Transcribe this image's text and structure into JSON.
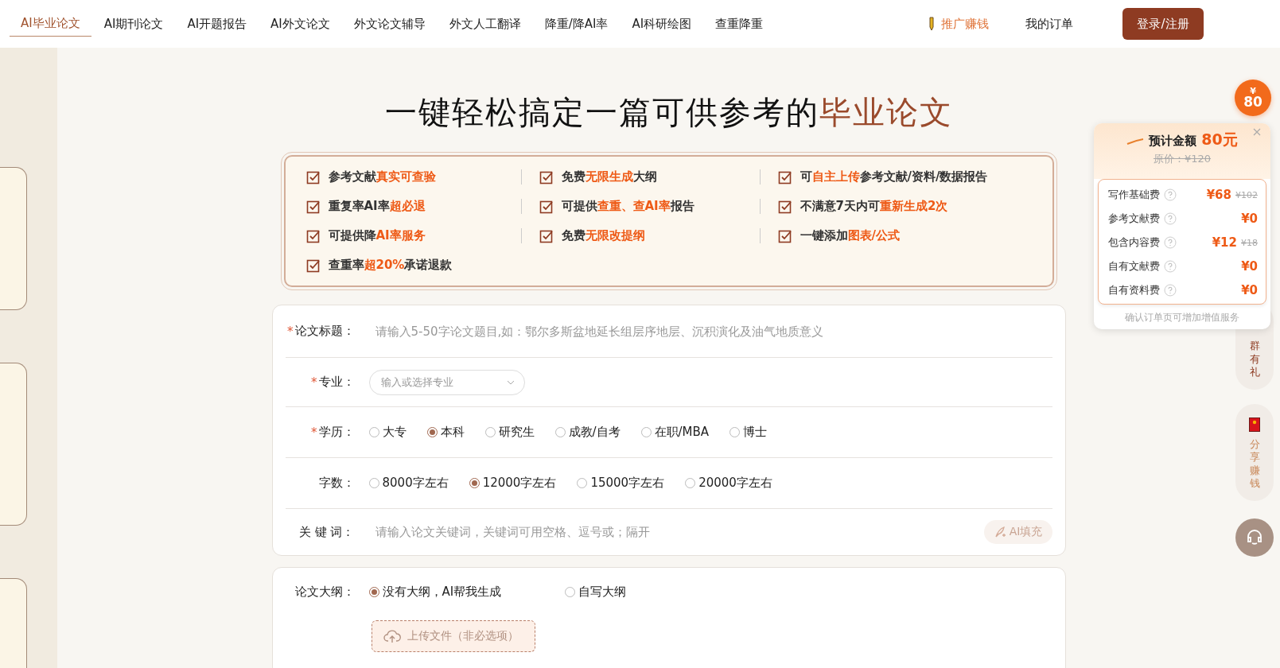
{
  "nav": {
    "items": [
      {
        "label": "AI毕业论文",
        "selected": true
      },
      {
        "label": "AI期刊论文",
        "selected": false
      },
      {
        "label": "AI开题报告",
        "selected": false
      },
      {
        "label": "AI外文论文",
        "selected": false
      },
      {
        "label": "外文论文辅导",
        "selected": false
      },
      {
        "label": "外文人工翻译",
        "selected": false
      },
      {
        "label": "降重/降AI率",
        "selected": false
      },
      {
        "label": "AI科研绘图",
        "selected": false
      },
      {
        "label": "查重降重",
        "selected": false
      }
    ],
    "promo": "推广赚钱",
    "orders": "我的订单",
    "login": "登录/注册"
  },
  "headline": "一键轻松搞定一篇可供参考的**毕业论文**",
  "features": [
    "参考文献**真实可查验**",
    "免费**无限生成**大纲",
    "可**自主上传**参考文献/资料/数据报告",
    "重复率AI率**超必退**",
    "可提供**查重、查AI率**报告",
    "不满意7天内可**重新生成2次**",
    "可提供降**AI率服务**",
    "免费**无限改提纲**",
    "一键添加**图表/公式**",
    "查重率**超20%**承诺退款"
  ],
  "form": {
    "fields": [
      {
        "kind": "text",
        "mark": "*",
        "label": "论文标题：",
        "placeholder": "请输入5-50字论文题目,如：鄂尔多斯盆地延长组层序地层、沉积演化及油气地质意义"
      },
      {
        "kind": "select",
        "mark": "*",
        "label": "专业：",
        "placeholder": "输入或选择专业"
      },
      {
        "kind": "radio",
        "mark": "*",
        "label": "学历：",
        "options": [
          {
            "label": "大专",
            "selected": false
          },
          {
            "label": "本科",
            "selected": true
          },
          {
            "label": "研究生",
            "selected": false
          },
          {
            "label": "成教/自考",
            "selected": false
          },
          {
            "label": "在职/MBA",
            "selected": false
          },
          {
            "label": "博士",
            "selected": false
          }
        ]
      },
      {
        "kind": "radio",
        "label": "字数：",
        "options": [
          {
            "label": "8000字左右",
            "selected": false
          },
          {
            "label": "12000字左右",
            "selected": true
          },
          {
            "label": "15000字左右",
            "selected": false
          },
          {
            "label": "20000字左右",
            "selected": false
          }
        ]
      },
      {
        "kind": "text",
        "label": "关 键 词：",
        "placeholder": "请输入论文关键词，关键词可用空格、逗号或；隔开",
        "action": "AI填充"
      }
    ]
  },
  "outline": {
    "label": "论文大纲：",
    "options": [
      {
        "label": "没有大纲，AI帮我生成",
        "selected": true
      },
      {
        "label": "自写大纲",
        "selected": false
      }
    ],
    "upload": "上传文件（非必选项）"
  },
  "price": {
    "badge_symbol": "¥",
    "badge_amount": "80",
    "title": "预计金额",
    "amount": "80元",
    "original": "原价：¥120",
    "rows": [
      {
        "label": "写作基础费",
        "price": "¥68",
        "original": "¥102"
      },
      {
        "label": "参考文献费",
        "price": "¥0"
      },
      {
        "label": "包含内容费",
        "price": "¥12",
        "original": "¥18"
      },
      {
        "label": "自有文献费",
        "price": "¥0"
      },
      {
        "label": "自有资料费",
        "price": "¥0"
      }
    ],
    "note": "确认订单页可增加增值服务"
  },
  "side": [
    {
      "kind": "group",
      "text": "群有礼"
    },
    {
      "kind": "share",
      "text": "分享赚钱"
    }
  ]
}
